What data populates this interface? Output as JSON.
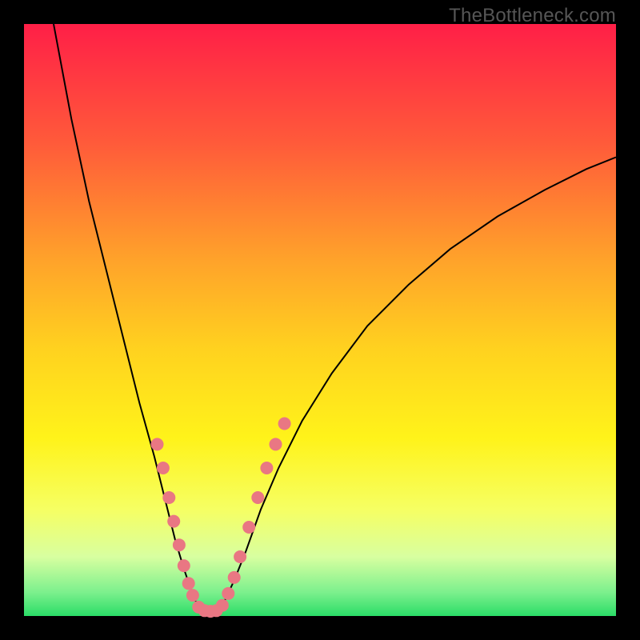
{
  "watermark": "TheBottleneck.com",
  "chart_data": {
    "type": "line",
    "title": "",
    "xlabel": "",
    "ylabel": "",
    "xlim": [
      0,
      100
    ],
    "ylim": [
      0,
      100
    ],
    "background_gradient": {
      "direction": "vertical",
      "stops": [
        {
          "pos": 0.0,
          "color": "#ff1f47"
        },
        {
          "pos": 0.2,
          "color": "#ff5a3a"
        },
        {
          "pos": 0.4,
          "color": "#ffa32a"
        },
        {
          "pos": 0.55,
          "color": "#ffd21f"
        },
        {
          "pos": 0.7,
          "color": "#fff31a"
        },
        {
          "pos": 0.82,
          "color": "#f6ff63"
        },
        {
          "pos": 0.9,
          "color": "#d8ffa0"
        },
        {
          "pos": 0.96,
          "color": "#7cf08d"
        },
        {
          "pos": 1.0,
          "color": "#2bdc67"
        }
      ]
    },
    "series": [
      {
        "name": "v-curve",
        "stroke": "#000000",
        "stroke_width": 2,
        "points": [
          {
            "x": 5.0,
            "y": 100.0
          },
          {
            "x": 8.0,
            "y": 84.0
          },
          {
            "x": 11.0,
            "y": 70.0
          },
          {
            "x": 14.0,
            "y": 58.0
          },
          {
            "x": 17.0,
            "y": 46.0
          },
          {
            "x": 19.5,
            "y": 36.0
          },
          {
            "x": 22.0,
            "y": 27.0
          },
          {
            "x": 24.0,
            "y": 19.0
          },
          {
            "x": 25.5,
            "y": 13.0
          },
          {
            "x": 27.0,
            "y": 8.0
          },
          {
            "x": 28.2,
            "y": 4.5
          },
          {
            "x": 29.0,
            "y": 2.5
          },
          {
            "x": 30.0,
            "y": 1.3
          },
          {
            "x": 31.0,
            "y": 0.8
          },
          {
            "x": 32.0,
            "y": 0.8
          },
          {
            "x": 33.0,
            "y": 1.3
          },
          {
            "x": 34.0,
            "y": 2.8
          },
          {
            "x": 35.5,
            "y": 6.0
          },
          {
            "x": 37.5,
            "y": 11.0
          },
          {
            "x": 40.0,
            "y": 18.0
          },
          {
            "x": 43.0,
            "y": 25.0
          },
          {
            "x": 47.0,
            "y": 33.0
          },
          {
            "x": 52.0,
            "y": 41.0
          },
          {
            "x": 58.0,
            "y": 49.0
          },
          {
            "x": 65.0,
            "y": 56.0
          },
          {
            "x": 72.0,
            "y": 62.0
          },
          {
            "x": 80.0,
            "y": 67.5
          },
          {
            "x": 88.0,
            "y": 72.0
          },
          {
            "x": 95.0,
            "y": 75.5
          },
          {
            "x": 100.0,
            "y": 77.5
          }
        ]
      }
    ],
    "markers": {
      "name": "dots",
      "color": "#e97783",
      "radius": 8,
      "points": [
        {
          "x": 22.5,
          "y": 29.0
        },
        {
          "x": 23.5,
          "y": 25.0
        },
        {
          "x": 24.5,
          "y": 20.0
        },
        {
          "x": 25.3,
          "y": 16.0
        },
        {
          "x": 26.2,
          "y": 12.0
        },
        {
          "x": 27.0,
          "y": 8.5
        },
        {
          "x": 27.8,
          "y": 5.5
        },
        {
          "x": 28.5,
          "y": 3.5
        },
        {
          "x": 29.5,
          "y": 1.5
        },
        {
          "x": 30.5,
          "y": 0.9
        },
        {
          "x": 31.5,
          "y": 0.8
        },
        {
          "x": 32.5,
          "y": 0.9
        },
        {
          "x": 33.5,
          "y": 1.8
        },
        {
          "x": 34.5,
          "y": 3.8
        },
        {
          "x": 35.5,
          "y": 6.5
        },
        {
          "x": 36.5,
          "y": 10.0
        },
        {
          "x": 38.0,
          "y": 15.0
        },
        {
          "x": 39.5,
          "y": 20.0
        },
        {
          "x": 41.0,
          "y": 25.0
        },
        {
          "x": 42.5,
          "y": 29.0
        },
        {
          "x": 44.0,
          "y": 32.5
        }
      ]
    }
  }
}
